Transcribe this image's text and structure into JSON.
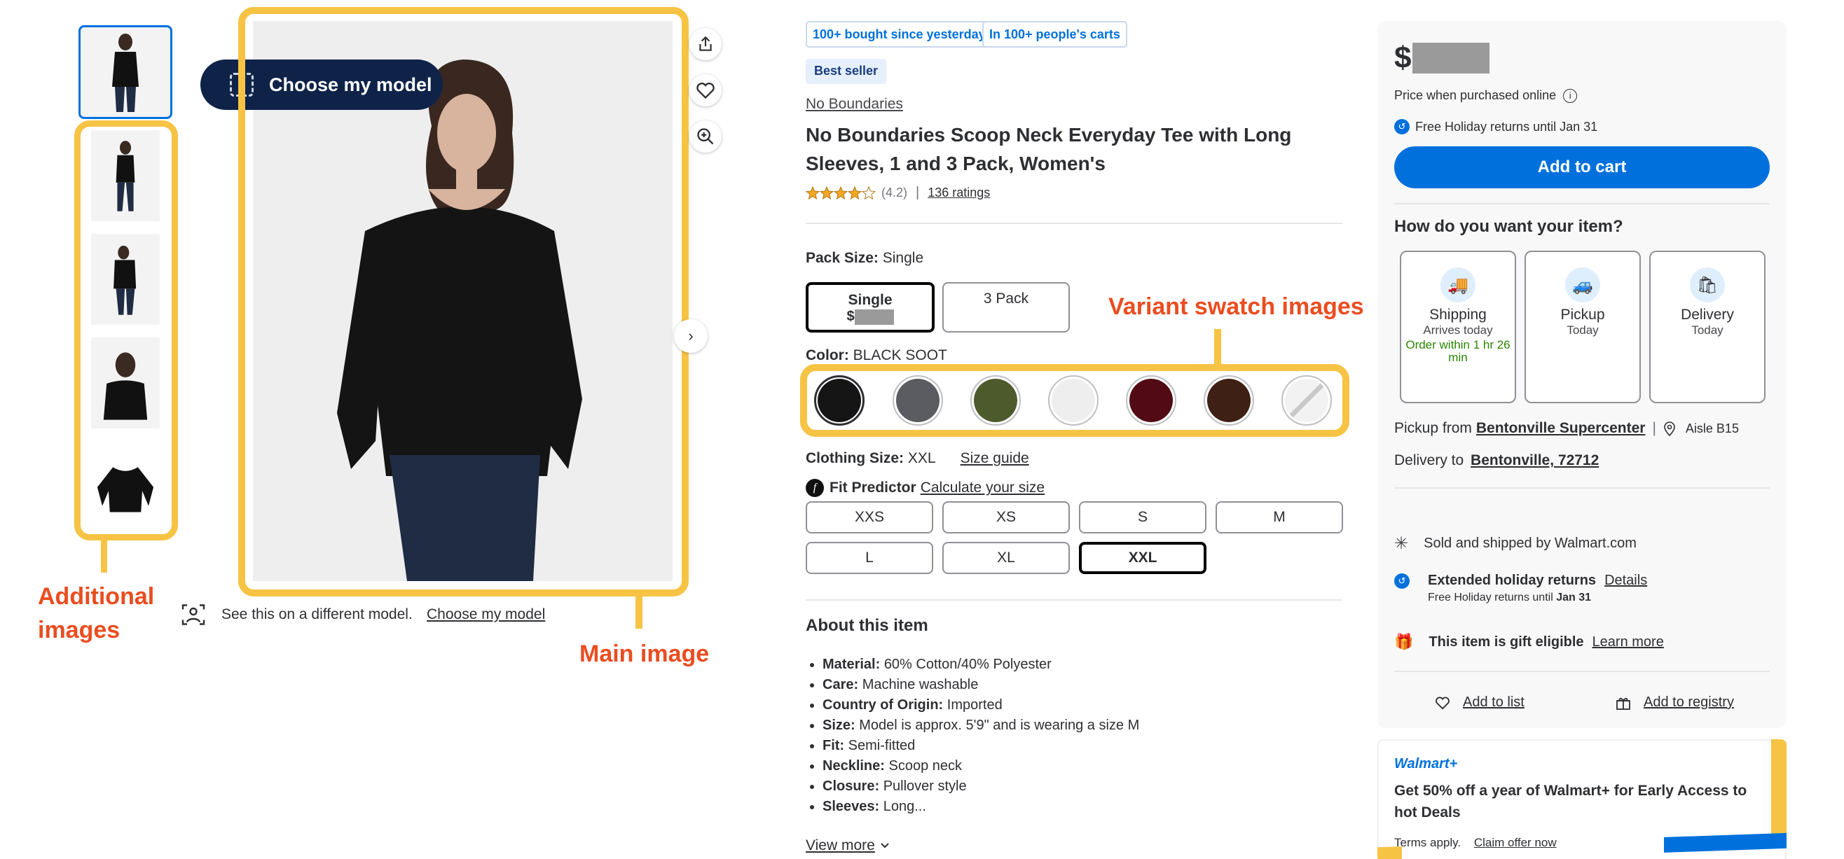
{
  "gallery": {
    "choose_model_label": "Choose my model",
    "different_model_text": "See this on a different model.",
    "different_model_link": "Choose my model"
  },
  "annotations": {
    "additional_images": "Additional images",
    "main_image": "Main image",
    "variant_swatches": "Variant swatch images"
  },
  "product": {
    "badges": [
      "100+ bought since yesterday",
      "In 100+ people's carts"
    ],
    "best_seller": "Best seller",
    "brand": "No Boundaries",
    "title": "No Boundaries Scoop Neck Everyday Tee with Long Sleeves, 1 and 3 Pack, Women's",
    "rating": "(4.2)",
    "rating_value": 4.2,
    "ratings_link": "136 ratings",
    "pack_size_label": "Pack Size:",
    "pack_size_value": "Single",
    "pack_options": [
      {
        "label": "Single",
        "price_prefix": "$"
      },
      {
        "label": "3 Pack"
      }
    ],
    "color_label": "Color:",
    "color_value": "BLACK SOOT",
    "swatches": [
      {
        "color": "#151515"
      },
      {
        "color": "#5b5c61"
      },
      {
        "color": "#4d5a2b"
      },
      {
        "color": "#eeeeee"
      },
      {
        "color": "#520a14"
      },
      {
        "color": "#3f2015"
      },
      {
        "color": "#f2f2f2"
      }
    ],
    "clothing_size_label": "Clothing Size:",
    "clothing_size_value": "XXL",
    "size_guide": "Size guide",
    "fit_predictor_label": "Fit Predictor",
    "fit_predictor_link": "Calculate your size",
    "sizes": [
      "XXS",
      "XS",
      "S",
      "M",
      "L",
      "XL",
      "XXL"
    ],
    "about_title": "About this item",
    "details": [
      {
        "k": "Material:",
        "v": "60% Cotton/40% Polyester"
      },
      {
        "k": "Care:",
        "v": "Machine washable"
      },
      {
        "k": "Country of Origin:",
        "v": "Imported"
      },
      {
        "k": "Size:",
        "v": "Model is approx. 5'9\" and is wearing a size M"
      },
      {
        "k": "Fit:",
        "v": "Semi-fitted"
      },
      {
        "k": "Neckline:",
        "v": "Scoop neck"
      },
      {
        "k": "Closure:",
        "v": "Pullover style"
      },
      {
        "k": "Sleeves:",
        "v": "Long..."
      }
    ],
    "view_more": "View more"
  },
  "buybox": {
    "currency": "$",
    "price_note": "Price when purchased online",
    "holiday_returns": "Free Holiday returns until Jan 31",
    "add_to_cart": "Add to cart",
    "how_title": "How do you want your item?",
    "options": [
      {
        "title": "Shipping",
        "sub": "Arrives today",
        "green": "Order within 1 hr 26 min"
      },
      {
        "title": "Pickup",
        "sub": "Today"
      },
      {
        "title": "Delivery",
        "sub": "Today"
      }
    ],
    "pickup_from_label": "Pickup from",
    "pickup_store": "Bentonville Supercenter",
    "aisle": "Aisle B15",
    "delivery_to_label": "Delivery to",
    "delivery_location": "Bentonville, 72712",
    "sold_by": "Sold and shipped by Walmart.com",
    "extended_returns": "Extended holiday returns",
    "details_link": "Details",
    "free_returns_prefix": "Free Holiday returns until",
    "free_returns_date": "Jan 31",
    "gift_eligible": "This item is gift eligible",
    "learn_more": "Learn more",
    "add_to_list": "Add to list",
    "add_to_registry": "Add to registry",
    "accent": "#0071dc"
  },
  "promo": {
    "brand": "Walmart+",
    "text": "Get 50% off a year of Walmart+ for Early Access to hot Deals",
    "terms": "Terms apply.",
    "claim": "Claim offer now"
  }
}
